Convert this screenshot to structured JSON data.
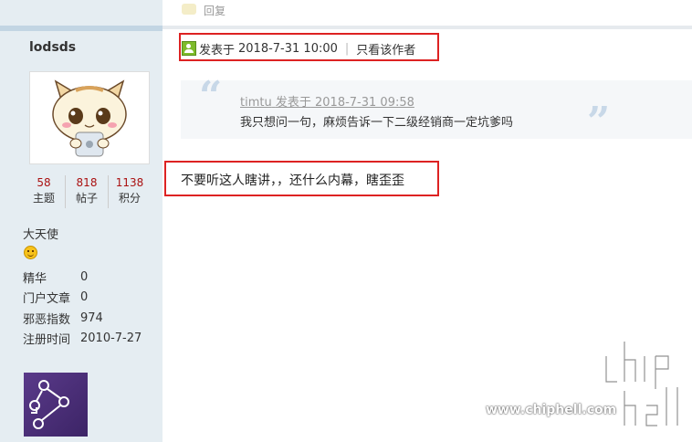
{
  "post": {
    "reply_label": "回复",
    "posted_prefix": "发表于",
    "posted_time": "2018-7-31 10:00",
    "only_author_label": "只看该作者",
    "quote": {
      "author": "timtu",
      "posted_prefix": "发表于",
      "posted_time": "2018-7-31 09:58",
      "text": "我只想问一句，麻烦告诉一下二级经销商一定坑爹吗"
    },
    "message": "不要听这人瞎讲，，还什么内幕，瞎歪歪"
  },
  "user": {
    "username": "lodsds",
    "stats": [
      {
        "value": "58",
        "label": "主题"
      },
      {
        "value": "818",
        "label": "帖子"
      },
      {
        "value": "1138",
        "label": "积分"
      }
    ],
    "rank": "大天使",
    "details": [
      {
        "label": "精华",
        "value": "0"
      },
      {
        "label": "门户文章",
        "value": "0"
      },
      {
        "label": "邪恶指数",
        "value": "974"
      },
      {
        "label": "注册时间",
        "value": "2010-7-27"
      }
    ]
  },
  "watermark": {
    "url": "www.chiphell.com",
    "logo": "chiphell"
  },
  "colors": {
    "sidebar_bg": "#e5edf2",
    "highlight_box": "#dd2222",
    "stat_number": "#aa1111",
    "quote_bg": "#f5f7f9"
  },
  "icons": {
    "reply": "reply-icon",
    "online": "online-user-icon",
    "rank": "smiley-icon",
    "quote_open": "quote-open-icon",
    "quote_close": "quote-close-icon"
  }
}
